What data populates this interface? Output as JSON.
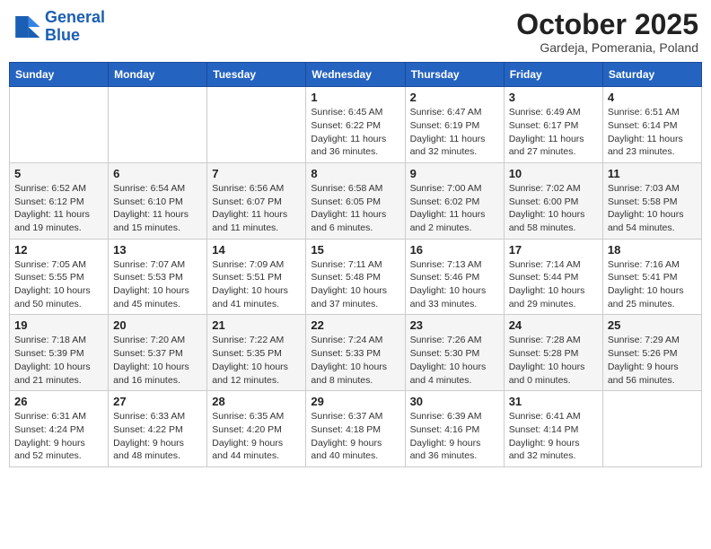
{
  "header": {
    "logo_line1": "General",
    "logo_line2": "Blue",
    "month_title": "October 2025",
    "subtitle": "Gardeja, Pomerania, Poland"
  },
  "weekdays": [
    "Sunday",
    "Monday",
    "Tuesday",
    "Wednesday",
    "Thursday",
    "Friday",
    "Saturday"
  ],
  "weeks": [
    [
      {
        "day": null,
        "info": null
      },
      {
        "day": null,
        "info": null
      },
      {
        "day": null,
        "info": null
      },
      {
        "day": "1",
        "info": "Sunrise: 6:45 AM\nSunset: 6:22 PM\nDaylight: 11 hours\nand 36 minutes."
      },
      {
        "day": "2",
        "info": "Sunrise: 6:47 AM\nSunset: 6:19 PM\nDaylight: 11 hours\nand 32 minutes."
      },
      {
        "day": "3",
        "info": "Sunrise: 6:49 AM\nSunset: 6:17 PM\nDaylight: 11 hours\nand 27 minutes."
      },
      {
        "day": "4",
        "info": "Sunrise: 6:51 AM\nSunset: 6:14 PM\nDaylight: 11 hours\nand 23 minutes."
      }
    ],
    [
      {
        "day": "5",
        "info": "Sunrise: 6:52 AM\nSunset: 6:12 PM\nDaylight: 11 hours\nand 19 minutes."
      },
      {
        "day": "6",
        "info": "Sunrise: 6:54 AM\nSunset: 6:10 PM\nDaylight: 11 hours\nand 15 minutes."
      },
      {
        "day": "7",
        "info": "Sunrise: 6:56 AM\nSunset: 6:07 PM\nDaylight: 11 hours\nand 11 minutes."
      },
      {
        "day": "8",
        "info": "Sunrise: 6:58 AM\nSunset: 6:05 PM\nDaylight: 11 hours\nand 6 minutes."
      },
      {
        "day": "9",
        "info": "Sunrise: 7:00 AM\nSunset: 6:02 PM\nDaylight: 11 hours\nand 2 minutes."
      },
      {
        "day": "10",
        "info": "Sunrise: 7:02 AM\nSunset: 6:00 PM\nDaylight: 10 hours\nand 58 minutes."
      },
      {
        "day": "11",
        "info": "Sunrise: 7:03 AM\nSunset: 5:58 PM\nDaylight: 10 hours\nand 54 minutes."
      }
    ],
    [
      {
        "day": "12",
        "info": "Sunrise: 7:05 AM\nSunset: 5:55 PM\nDaylight: 10 hours\nand 50 minutes."
      },
      {
        "day": "13",
        "info": "Sunrise: 7:07 AM\nSunset: 5:53 PM\nDaylight: 10 hours\nand 45 minutes."
      },
      {
        "day": "14",
        "info": "Sunrise: 7:09 AM\nSunset: 5:51 PM\nDaylight: 10 hours\nand 41 minutes."
      },
      {
        "day": "15",
        "info": "Sunrise: 7:11 AM\nSunset: 5:48 PM\nDaylight: 10 hours\nand 37 minutes."
      },
      {
        "day": "16",
        "info": "Sunrise: 7:13 AM\nSunset: 5:46 PM\nDaylight: 10 hours\nand 33 minutes."
      },
      {
        "day": "17",
        "info": "Sunrise: 7:14 AM\nSunset: 5:44 PM\nDaylight: 10 hours\nand 29 minutes."
      },
      {
        "day": "18",
        "info": "Sunrise: 7:16 AM\nSunset: 5:41 PM\nDaylight: 10 hours\nand 25 minutes."
      }
    ],
    [
      {
        "day": "19",
        "info": "Sunrise: 7:18 AM\nSunset: 5:39 PM\nDaylight: 10 hours\nand 21 minutes."
      },
      {
        "day": "20",
        "info": "Sunrise: 7:20 AM\nSunset: 5:37 PM\nDaylight: 10 hours\nand 16 minutes."
      },
      {
        "day": "21",
        "info": "Sunrise: 7:22 AM\nSunset: 5:35 PM\nDaylight: 10 hours\nand 12 minutes."
      },
      {
        "day": "22",
        "info": "Sunrise: 7:24 AM\nSunset: 5:33 PM\nDaylight: 10 hours\nand 8 minutes."
      },
      {
        "day": "23",
        "info": "Sunrise: 7:26 AM\nSunset: 5:30 PM\nDaylight: 10 hours\nand 4 minutes."
      },
      {
        "day": "24",
        "info": "Sunrise: 7:28 AM\nSunset: 5:28 PM\nDaylight: 10 hours\nand 0 minutes."
      },
      {
        "day": "25",
        "info": "Sunrise: 7:29 AM\nSunset: 5:26 PM\nDaylight: 9 hours\nand 56 minutes."
      }
    ],
    [
      {
        "day": "26",
        "info": "Sunrise: 6:31 AM\nSunset: 4:24 PM\nDaylight: 9 hours\nand 52 minutes."
      },
      {
        "day": "27",
        "info": "Sunrise: 6:33 AM\nSunset: 4:22 PM\nDaylight: 9 hours\nand 48 minutes."
      },
      {
        "day": "28",
        "info": "Sunrise: 6:35 AM\nSunset: 4:20 PM\nDaylight: 9 hours\nand 44 minutes."
      },
      {
        "day": "29",
        "info": "Sunrise: 6:37 AM\nSunset: 4:18 PM\nDaylight: 9 hours\nand 40 minutes."
      },
      {
        "day": "30",
        "info": "Sunrise: 6:39 AM\nSunset: 4:16 PM\nDaylight: 9 hours\nand 36 minutes."
      },
      {
        "day": "31",
        "info": "Sunrise: 6:41 AM\nSunset: 4:14 PM\nDaylight: 9 hours\nand 32 minutes."
      },
      {
        "day": null,
        "info": null
      }
    ]
  ]
}
